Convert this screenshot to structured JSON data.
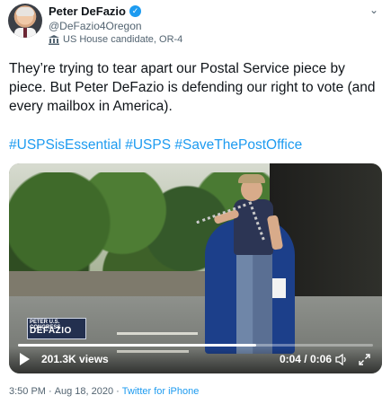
{
  "author": {
    "display_name": "Peter DeFazio",
    "handle": "@DeFazio4Oregon",
    "label": "US House candidate, OR-4"
  },
  "icons": {
    "verified": "verified-badge-icon",
    "label": "government-building-icon",
    "menu": "chevron-down-icon",
    "play": "play-icon",
    "volume": "volume-icon",
    "fullscreen": "expand-icon"
  },
  "tweet": {
    "text": "They’re trying to tear apart our Postal Service piece by piece. But Peter DeFazio is defending our right to vote (and every mailbox in America).",
    "hashtags": "#USPSisEssential #USPS #SaveThePostOffice"
  },
  "video": {
    "views": "201.3K views",
    "time": "0:04 / 0:06",
    "progress": 0.67,
    "overlay_line1": "PETER U.S. CONGRESS",
    "overlay_line2": "DEFAZIO"
  },
  "meta": {
    "time": "3:50 PM",
    "date": "Aug 18, 2020",
    "separator": "·",
    "source": "Twitter for iPhone"
  },
  "colors": {
    "accent": "#1d9bf0",
    "secondary_text": "#536471",
    "primary_text": "#0f1419"
  }
}
